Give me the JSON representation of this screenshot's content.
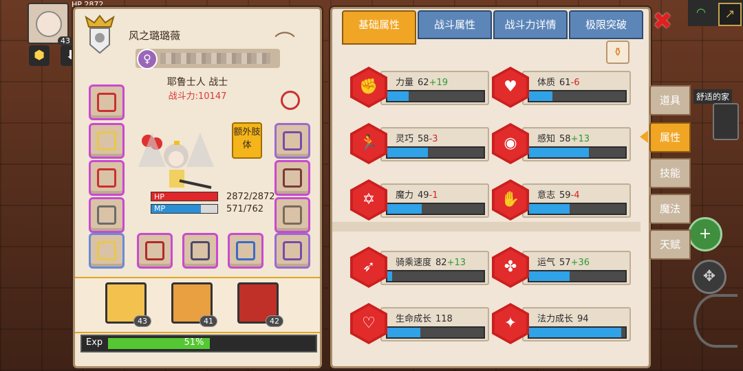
{
  "character": {
    "name": "风之璐璐薇",
    "class_label": "耶鲁士人 战士",
    "power": "战斗力:10147",
    "extra_limb": "额外肢体",
    "hp_label": "HP",
    "mp_label": "MP",
    "hp_value": "2872/2872",
    "mp_value": "571/762",
    "mp_fraction": 0.75
  },
  "hud": {
    "hp_text": "HP 2872"
  },
  "party": [
    {
      "level": "43"
    },
    {
      "level": "41"
    },
    {
      "level": "42"
    }
  ],
  "exp": {
    "label": "Exp",
    "percent": "51%",
    "fraction": 0.51
  },
  "tabs": [
    "基础属性",
    "战斗属性",
    "战斗力详情",
    "极限突破"
  ],
  "side_tabs": [
    "道具",
    "属性",
    "技能",
    "魔法",
    "天赋"
  ],
  "home_label": "舒适的家",
  "stats": [
    {
      "name": "力量",
      "value": "62",
      "mod": "+19",
      "mod_type": "plus",
      "fill": 0.22
    },
    {
      "name": "体质",
      "value": "61",
      "mod": "-6",
      "mod_type": "minus",
      "fill": 0.24
    },
    {
      "name": "灵巧",
      "value": "58",
      "mod": "-3",
      "mod_type": "minus",
      "fill": 0.42
    },
    {
      "name": "感知",
      "value": "58",
      "mod": "+13",
      "mod_type": "plus",
      "fill": 0.62
    },
    {
      "name": "魔力",
      "value": "49",
      "mod": "-1",
      "mod_type": "minus",
      "fill": 0.36
    },
    {
      "name": "意志",
      "value": "59",
      "mod": "-4",
      "mod_type": "minus",
      "fill": 0.42
    },
    {
      "name": "骑乘速度",
      "value": "82",
      "mod": "+13",
      "mod_type": "plus",
      "fill": 0.05
    },
    {
      "name": "运气",
      "value": "57",
      "mod": "+36",
      "mod_type": "plus",
      "fill": 0.42
    },
    {
      "name": "生命成长",
      "value": "118",
      "mod": "",
      "mod_type": "plus",
      "fill": 0.34
    },
    {
      "name": "法力成长",
      "value": "94",
      "mod": "",
      "mod_type": "plus",
      "fill": 0.96
    }
  ],
  "icons": {
    "stat_icons": [
      "strength-arm-icon",
      "constitution-heart-icon",
      "dexterity-runner-icon",
      "perception-eye-icon",
      "magic-hexagram-icon",
      "will-fist-icon",
      "riding-speed-wing-icon",
      "luck-clover-icon",
      "life-growth-heart-icon",
      "mana-growth-rune-icon"
    ],
    "close": "close-x-icon",
    "hanger": "hanger-icon",
    "gender": "female-icon",
    "potion": "potion-icon"
  },
  "colors": {
    "accent": "#f0a524",
    "tab_blue": "#5d86b8",
    "bar_blue": "#2fa2e8",
    "stat_red": "#e22b2b"
  }
}
